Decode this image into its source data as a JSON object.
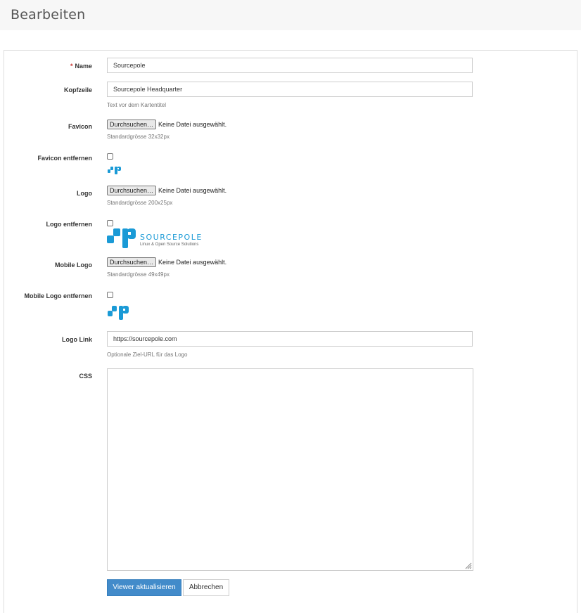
{
  "header": {
    "title": "Bearbeiten"
  },
  "form": {
    "name": {
      "label": "Name",
      "required_mark": "*",
      "value": "Sourcepole"
    },
    "kopfzeile": {
      "label": "Kopfzeile",
      "value": "Sourcepole Headquarter",
      "help": "Text vor dem Kartentitel"
    },
    "favicon": {
      "label": "Favicon",
      "button": "Durchsuchen…",
      "file_status": "Keine Datei ausgewählt.",
      "help": "Standardgrösse 32x32px"
    },
    "favicon_remove": {
      "label": "Favicon entfernen",
      "checked": false
    },
    "logo": {
      "label": "Logo",
      "button": "Durchsuchen…",
      "file_status": "Keine Datei ausgewählt.",
      "help": "Standardgrösse 200x25px"
    },
    "logo_remove": {
      "label": "Logo entfernen",
      "checked": false
    },
    "mobile_logo": {
      "label": "Mobile Logo",
      "button": "Durchsuchen…",
      "file_status": "Keine Datei ausgewählt.",
      "help": "Standardgrösse 49x49px"
    },
    "mobile_logo_remove": {
      "label": "Mobile Logo entfernen",
      "checked": false
    },
    "logo_link": {
      "label": "Logo Link",
      "value": "https://sourcepole.com",
      "help": "Optionale Ziel-URL für das Logo"
    },
    "css": {
      "label": "CSS",
      "value": ""
    }
  },
  "logo_preview": {
    "brand": "SOURCEPOLE",
    "tagline": "Linux & Open Source Solutions",
    "color": "#1a9ad6"
  },
  "actions": {
    "submit": "Viewer aktualisieren",
    "cancel": "Abbrechen"
  },
  "colors": {
    "primary": "#428bca",
    "brand": "#1a9ad6",
    "required": "#c9302c"
  }
}
